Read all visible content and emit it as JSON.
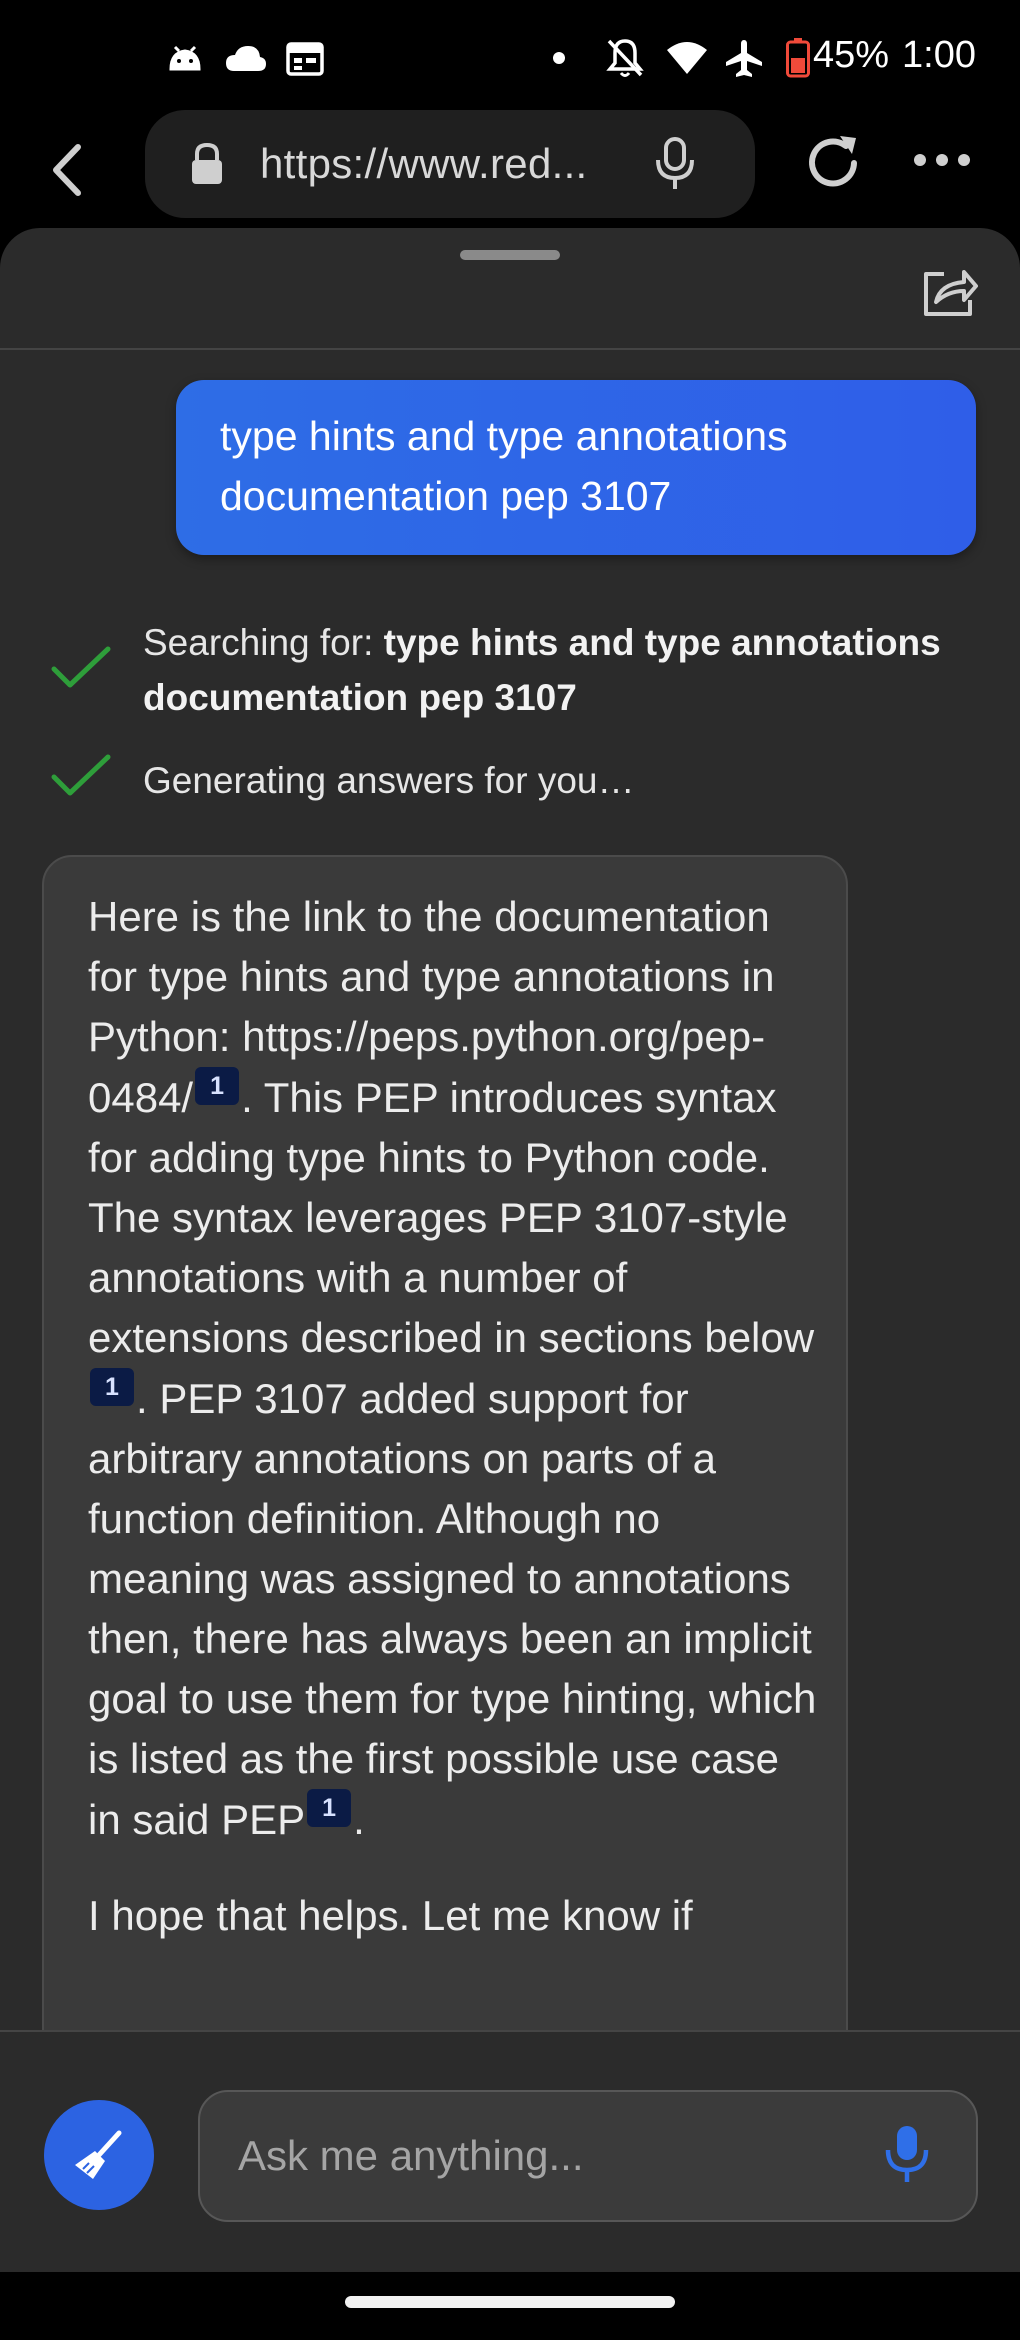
{
  "status_bar": {
    "battery": "45%",
    "time": "1:00",
    "icons": [
      "android-icon",
      "cloud-icon",
      "calendar-icon",
      "dot-icon",
      "mute-icon",
      "wifi-icon",
      "airplane-icon",
      "battery-icon"
    ]
  },
  "browser": {
    "url": "https://www.red..."
  },
  "chat": {
    "user_message": "type hints and type annotations documentation pep 3107",
    "steps": [
      {
        "prefix": "Searching for: ",
        "bold": "type hints and type annotations documentation pep 3107"
      },
      {
        "prefix": "Generating answers for you…",
        "bold": ""
      }
    ],
    "answer": {
      "seg1": "Here is the link to the documentation for type hints and type annotations in Python: https://peps.python.org/pep-0484/",
      "cite1": "1",
      "seg2": ". This PEP introduces syntax for adding type hints to Python code. The syntax leverages PEP 3107-style annotations with a number of extensions described in sections below",
      "cite2": "1",
      "seg3": ". PEP 3107 added support for arbitrary annotations on parts of a function definition. Although no meaning was assigned to annotations then, there has always been an implicit goal to use them for type hinting, which is listed as the first possible use case in said PEP",
      "cite3": "1",
      "seg4": ".",
      "followup": "I hope that helps. Let me know if"
    }
  },
  "input": {
    "placeholder": "Ask me anything..."
  },
  "colors": {
    "accent": "#2c63e2",
    "user_bubble": "#2e6de6",
    "check": "#2e9e3a",
    "sheet": "#2b2b2b",
    "answer_bubble": "#3a3a3a"
  }
}
